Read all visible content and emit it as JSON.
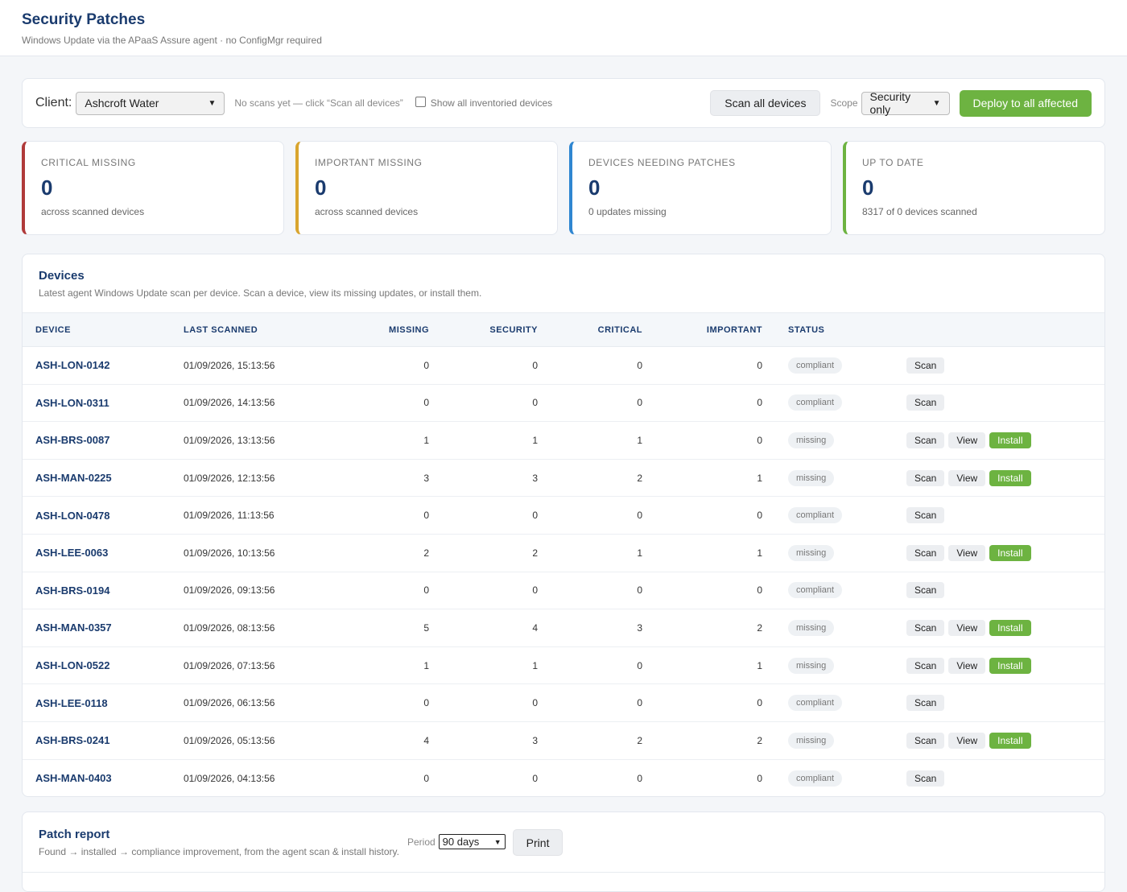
{
  "header": {
    "title": "Security Patches",
    "subtitle": "Windows Update via the APaaS Assure agent · no ConfigMgr required"
  },
  "toolbar": {
    "client_label": "Client:",
    "client_value": "Ashcroft Water",
    "hint": "No scans yet — click “Scan all devices”",
    "show_all_label": "Show all inventoried devices",
    "show_all_checked": false,
    "scan_all_label": "Scan all devices",
    "scope_label": "Scope",
    "scope_value": "Security only",
    "deploy_label": "Deploy to all affected"
  },
  "cards": [
    {
      "label": "CRITICAL MISSING",
      "value": "0",
      "sub": "across scanned devices",
      "color": "#b03a3a"
    },
    {
      "label": "IMPORTANT MISSING",
      "value": "0",
      "sub": "across scanned devices",
      "color": "#d9a52e"
    },
    {
      "label": "DEVICES NEEDING PATCHES",
      "value": "0",
      "sub": "0 updates missing",
      "color": "#2f86d1"
    },
    {
      "label": "UP TO DATE",
      "value": "0",
      "sub": "8317 of 0 devices scanned",
      "color": "#6db341"
    }
  ],
  "devices": {
    "title": "Devices",
    "subtitle": "Latest agent Windows Update scan per device. Scan a device, view its missing updates, or install them.",
    "columns": [
      "DEVICE",
      "LAST SCANNED",
      "MISSING",
      "SECURITY",
      "CRITICAL",
      "IMPORTANT",
      "STATUS"
    ],
    "action_labels": {
      "scan": "Scan",
      "view": "View",
      "install": "Install"
    },
    "rows": [
      {
        "device": "ASH-LON-0142",
        "last_scanned": "01/09/2026, 15:13:56",
        "missing": "0",
        "security": "0",
        "critical": "0",
        "important": "0",
        "status": "compliant"
      },
      {
        "device": "ASH-LON-0311",
        "last_scanned": "01/09/2026, 14:13:56",
        "missing": "0",
        "security": "0",
        "critical": "0",
        "important": "0",
        "status": "compliant"
      },
      {
        "device": "ASH-BRS-0087",
        "last_scanned": "01/09/2026, 13:13:56",
        "missing": "1",
        "security": "1",
        "critical": "1",
        "important": "0",
        "status": "missing"
      },
      {
        "device": "ASH-MAN-0225",
        "last_scanned": "01/09/2026, 12:13:56",
        "missing": "3",
        "security": "3",
        "critical": "2",
        "important": "1",
        "status": "missing"
      },
      {
        "device": "ASH-LON-0478",
        "last_scanned": "01/09/2026, 11:13:56",
        "missing": "0",
        "security": "0",
        "critical": "0",
        "important": "0",
        "status": "compliant"
      },
      {
        "device": "ASH-LEE-0063",
        "last_scanned": "01/09/2026, 10:13:56",
        "missing": "2",
        "security": "2",
        "critical": "1",
        "important": "1",
        "status": "missing"
      },
      {
        "device": "ASH-BRS-0194",
        "last_scanned": "01/09/2026, 09:13:56",
        "missing": "0",
        "security": "0",
        "critical": "0",
        "important": "0",
        "status": "compliant"
      },
      {
        "device": "ASH-MAN-0357",
        "last_scanned": "01/09/2026, 08:13:56",
        "missing": "5",
        "security": "4",
        "critical": "3",
        "important": "2",
        "status": "missing"
      },
      {
        "device": "ASH-LON-0522",
        "last_scanned": "01/09/2026, 07:13:56",
        "missing": "1",
        "security": "1",
        "critical": "0",
        "important": "1",
        "status": "missing"
      },
      {
        "device": "ASH-LEE-0118",
        "last_scanned": "01/09/2026, 06:13:56",
        "missing": "0",
        "security": "0",
        "critical": "0",
        "important": "0",
        "status": "compliant"
      },
      {
        "device": "ASH-BRS-0241",
        "last_scanned": "01/09/2026, 05:13:56",
        "missing": "4",
        "security": "3",
        "critical": "2",
        "important": "2",
        "status": "missing"
      },
      {
        "device": "ASH-MAN-0403",
        "last_scanned": "01/09/2026, 04:13:56",
        "missing": "0",
        "security": "0",
        "critical": "0",
        "important": "0",
        "status": "compliant"
      }
    ]
  },
  "report": {
    "title": "Patch report",
    "subtitle": "Found → installed → compliance improvement, from the agent scan & install history.",
    "period_label": "Period",
    "period_value": "90 days",
    "print_label": "Print"
  }
}
